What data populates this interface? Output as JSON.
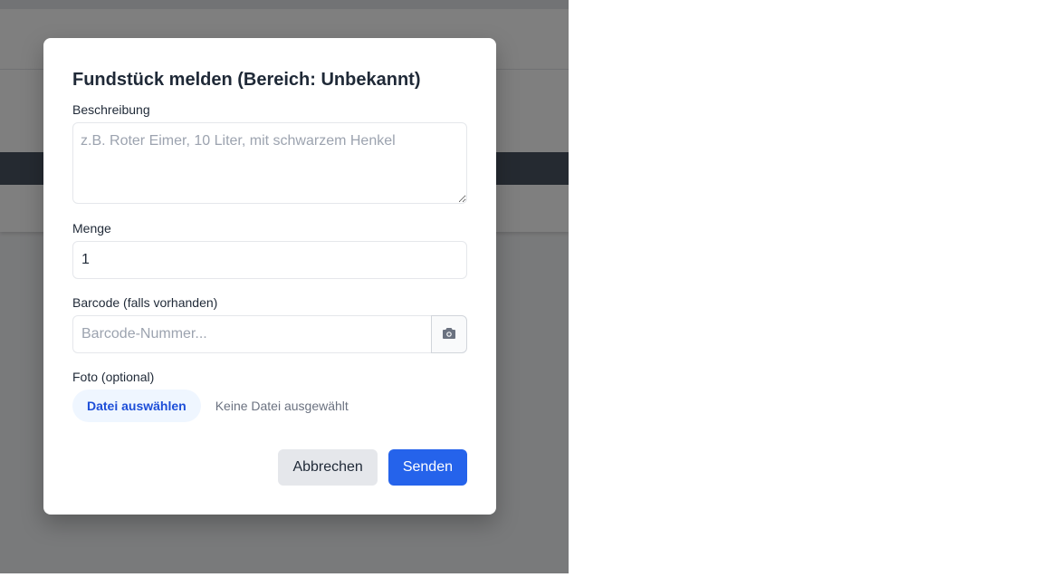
{
  "modal": {
    "title": "Fundstück melden (Bereich: Unbekannt)",
    "description": {
      "label": "Beschreibung",
      "placeholder": "z.B. Roter Eimer, 10 Liter, mit schwarzem Henkel",
      "value": ""
    },
    "quantity": {
      "label": "Menge",
      "value": "1"
    },
    "barcode": {
      "label": "Barcode (falls vorhanden)",
      "placeholder": "Barcode-Nummer...",
      "value": "",
      "scan_icon": "camera-icon"
    },
    "photo": {
      "label": "Foto (optional)",
      "button_label": "Datei auswählen",
      "status": "Keine Datei ausgewählt"
    },
    "actions": {
      "cancel_label": "Abbrechen",
      "submit_label": "Senden"
    }
  },
  "colors": {
    "primary": "#2563eb",
    "file_button_bg": "#eff6ff",
    "file_button_text": "#1d4ed8",
    "overlay": "rgba(0,0,0,0.5)"
  }
}
